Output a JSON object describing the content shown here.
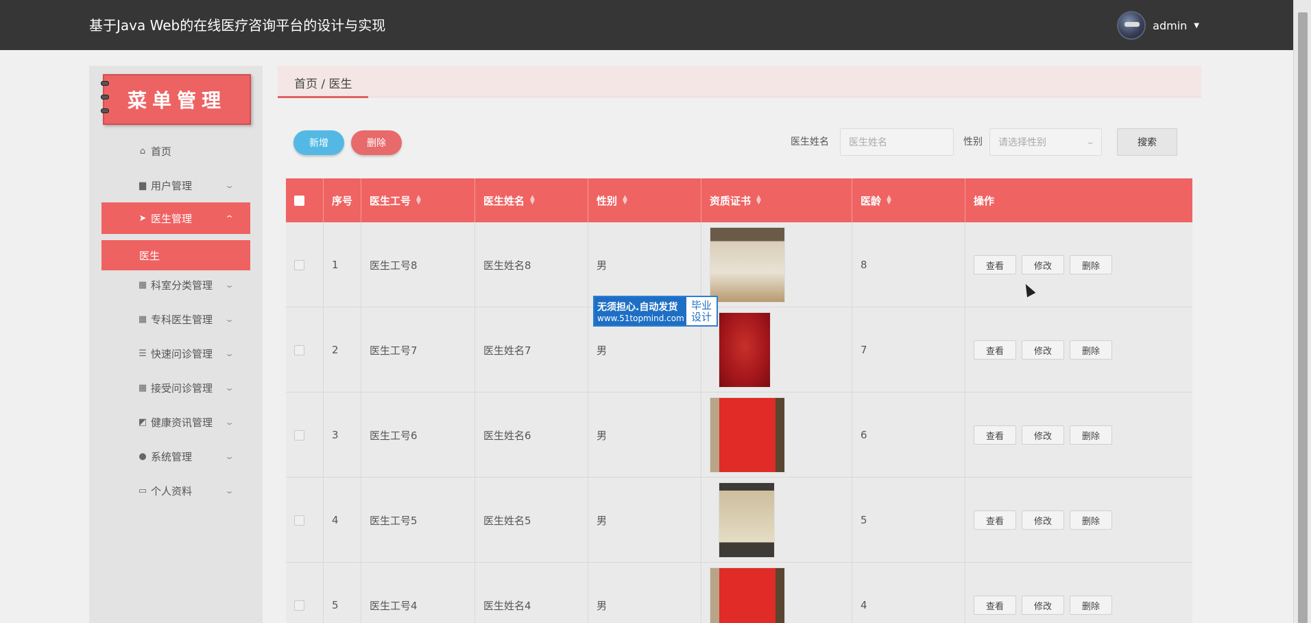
{
  "app": {
    "title": "基于Java Web的在线医疗咨询平台的设计与实现",
    "user": "admin"
  },
  "sidebar": {
    "banner": "菜单管理",
    "items": [
      {
        "label": "首页",
        "icon": "home-icon"
      },
      {
        "label": "用户管理",
        "icon": "user-card-icon"
      },
      {
        "label": "医生管理",
        "icon": "paper-plane-icon"
      },
      {
        "label": "科室分类管理",
        "icon": "grid-icon"
      },
      {
        "label": "专科医生管理",
        "icon": "grid-icon"
      },
      {
        "label": "快速问诊管理",
        "icon": "sliders-icon"
      },
      {
        "label": "接受问诊管理",
        "icon": "grid-icon"
      },
      {
        "label": "健康资讯管理",
        "icon": "chart-icon"
      },
      {
        "label": "系统管理",
        "icon": "person-icon"
      },
      {
        "label": "个人资料",
        "icon": "id-card-icon"
      }
    ],
    "sub_item": "医生"
  },
  "breadcrumb": "首页 / 医生",
  "toolbar": {
    "add": "新增",
    "delete": "删除",
    "name_label": "医生姓名",
    "name_placeholder": "医生姓名",
    "gender_label": "性别",
    "gender_placeholder": "请选择性别",
    "search": "搜索"
  },
  "table": {
    "headers": [
      "序号",
      "医生工号",
      "医生姓名",
      "性别",
      "资质证书",
      "医龄",
      "操作"
    ],
    "rows": [
      {
        "no": "1",
        "id": "医生工号8",
        "name": "医生姓名8",
        "gender": "男",
        "years": "8"
      },
      {
        "no": "2",
        "id": "医生工号7",
        "name": "医生姓名7",
        "gender": "男",
        "years": "7"
      },
      {
        "no": "3",
        "id": "医生工号6",
        "name": "医生姓名6",
        "gender": "男",
        "years": "6"
      },
      {
        "no": "4",
        "id": "医生工号5",
        "name": "医生姓名5",
        "gender": "男",
        "years": "5"
      },
      {
        "no": "5",
        "id": "医生工号4",
        "name": "医生姓名4",
        "gender": "男",
        "years": "4"
      }
    ],
    "actions": {
      "view": "查看",
      "edit": "修改",
      "delete": "删除"
    }
  },
  "watermark": {
    "line1": "无须担心.自动发货",
    "line2": "www.51topmind.com",
    "right1": "毕业",
    "right2": "设计"
  }
}
